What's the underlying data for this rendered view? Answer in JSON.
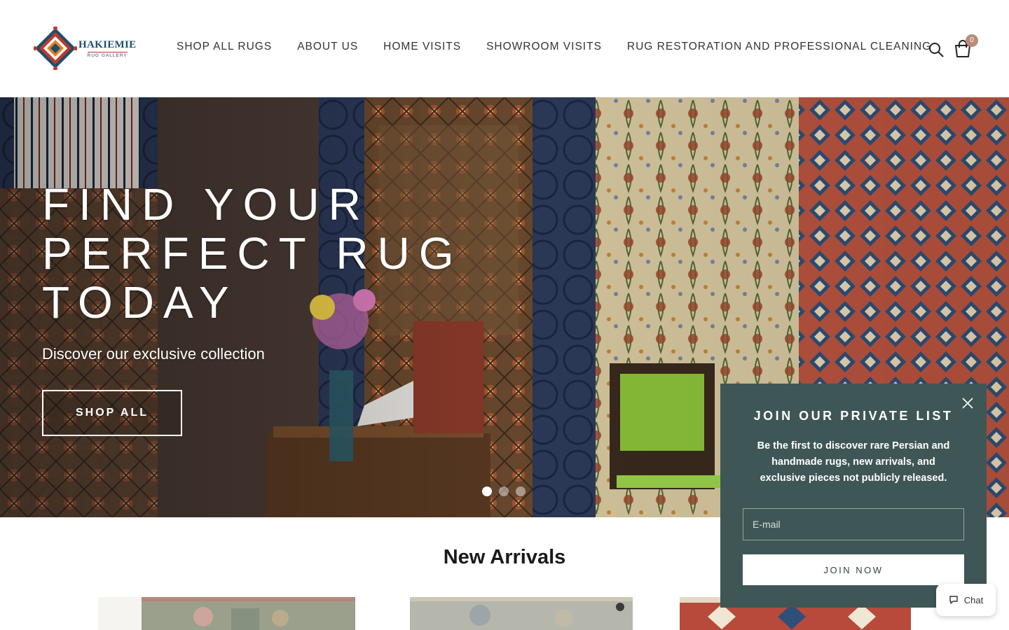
{
  "brand": {
    "name": "HAKIEMIE",
    "sub": "RUG GALLERY",
    "colors": {
      "primary": "#1f4e6b",
      "accent": "#c0392b"
    }
  },
  "nav": {
    "items": [
      {
        "label": "SHOP ALL RUGS"
      },
      {
        "label": "ABOUT US"
      },
      {
        "label": "HOME VISITS"
      },
      {
        "label": "SHOWROOM VISITS"
      },
      {
        "label": "RUG RESTORATION AND PROFESSIONAL CLEANING"
      }
    ],
    "search_icon": "search-icon",
    "cart_icon": "shopping-bag-icon",
    "cart_count": "0",
    "cart_badge_color": "#b98c7a"
  },
  "hero": {
    "title_lines": [
      "FIND YOUR",
      "PERFECT RUG",
      "TODAY"
    ],
    "subtitle": "Discover our exclusive collection",
    "button": "SHOP ALL",
    "slides": 3,
    "active_slide": 1
  },
  "new_arrivals": {
    "title": "New Arrivals",
    "products": 3
  },
  "popup": {
    "title": "JOIN OUR PRIVATE LIST",
    "text": "Be the first to discover rare Persian and handmade rugs, new arrivals, and exclusive pieces not publicly released.",
    "email_placeholder": "E-mail",
    "button": "JOIN NOW",
    "background": "#3f5656"
  },
  "chat": {
    "label": "Chat",
    "icon": "chat-bubble-icon"
  }
}
